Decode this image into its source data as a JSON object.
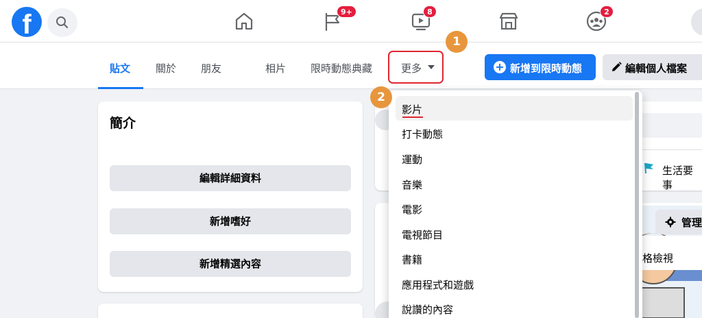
{
  "nav": {
    "logo_text": "f",
    "icons": [
      "search-icon",
      "home-icon",
      "flag-icon",
      "video-icon",
      "marketplace-icon",
      "groups-icon"
    ],
    "badges": {
      "pages": "9+",
      "watch": "8",
      "groups": "2"
    }
  },
  "tabs": [
    "貼文",
    "關於",
    "朋友",
    "相片",
    "限時動態典藏"
  ],
  "more": {
    "label": "更多"
  },
  "steps": {
    "first": "1",
    "second": "2"
  },
  "actions": {
    "add_story": "新增到限時動態",
    "edit_profile": "編輯個人檔案"
  },
  "intro": {
    "title": "簡介",
    "buttons": [
      "編輯詳細資料",
      "新增嗜好",
      "新增精選內容"
    ]
  },
  "right_content": {
    "life_event": "生活要事",
    "manage": "管理",
    "grid_view": "格檢視"
  },
  "dropdown": {
    "items": [
      "影片",
      "打卡動態",
      "運動",
      "音樂",
      "電影",
      "電視節目",
      "書籍",
      "應用程式和遊戲",
      "說讚的內容"
    ]
  },
  "colors": {
    "accent": "#1877f2",
    "badge": "#e41e3f",
    "step": "#e8963d",
    "highlight": "#e0262f"
  }
}
